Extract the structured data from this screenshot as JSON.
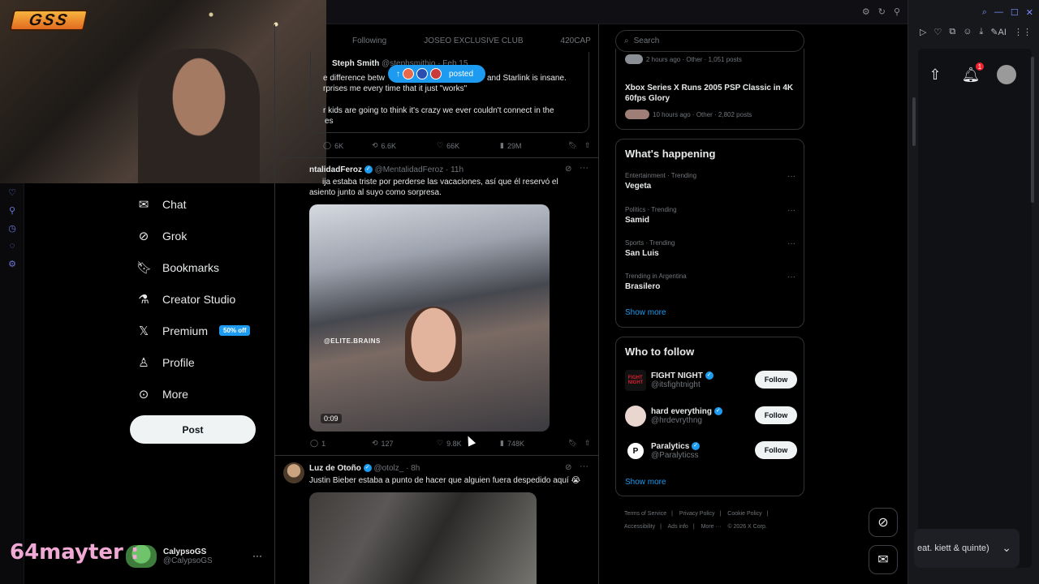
{
  "app_title": "X",
  "header": {
    "tabs": [
      {
        "label": "Following"
      },
      {
        "label": "JOSEO EXCLUSIVE CLUB"
      },
      {
        "label": "420CAP"
      }
    ]
  },
  "overlay": {
    "logo_text": "GSS",
    "chat_user": "64mayter :"
  },
  "posted_pill": {
    "label": "posted",
    "arrow": "↑"
  },
  "nav": {
    "items": [
      {
        "label": "Chat",
        "icon": "mail-icon"
      },
      {
        "label": "Grok",
        "icon": "grok-icon"
      },
      {
        "label": "Bookmarks",
        "icon": "bookmark-icon"
      },
      {
        "label": "Creator Studio",
        "icon": "creator-icon"
      },
      {
        "label": "Premium",
        "icon": "x-logo-icon",
        "badge": "50% off"
      },
      {
        "label": "Profile",
        "icon": "person-icon"
      },
      {
        "label": "More",
        "icon": "more-circle-icon"
      }
    ],
    "post_button": "Post"
  },
  "account": {
    "name": "CalypsoGS",
    "handle": "@CalypsoGS",
    "more": "···"
  },
  "quote_tweet": {
    "name": "Steph Smith",
    "handle": "@stephsmithio · Feb 15",
    "line1": "e difference betw",
    "line1b": "and Starlink is insane.",
    "line2": "rprises me every time that it just \"works\"",
    "line3": "r kids are going to think it's crazy we ever couldn't connect in the",
    "line4": "es",
    "stats": {
      "replies": "6K",
      "reposts": "6.6K",
      "likes": "66K",
      "views": "29M"
    }
  },
  "tweet1": {
    "name": "ntalidadFeroz",
    "handle": "@MentalidadFeroz · 11h",
    "line1": "ija estaba triste por perderse las vacaciones, así que él reservó el",
    "line2": "asiento junto al suyo como sorpresa.",
    "video_watermark": "@ELITE.BRAINS",
    "video_time": "0:09",
    "stats": {
      "replies": "1",
      "reposts": "127",
      "likes": "9.8K",
      "views": "748K"
    }
  },
  "tweet2": {
    "name": "Luz de Otoño",
    "handle": "@otolz_ · 8h",
    "text": "Justin Bieber estaba a punto de hacer que alguien fuera despedido aquí 😭"
  },
  "search": {
    "placeholder": "Search"
  },
  "top_trending": {
    "item0_meta": "2 hours ago · Other · 1,051 posts",
    "item1_title": "Xbox Series X Runs 2005 PSP Classic in 4K 60fps Glory",
    "item1_meta": "10 hours ago · Other · 2,802 posts"
  },
  "whats_happening": {
    "title": "What's happening",
    "trends": [
      {
        "meta": "Entertainment · Trending",
        "topic": "Vegeta"
      },
      {
        "meta": "Politics · Trending",
        "topic": "Samid"
      },
      {
        "meta": "Sports · Trending",
        "topic": "San Luis"
      },
      {
        "meta": "Trending in Argentina",
        "topic": "Brasilero"
      }
    ],
    "show_more": "Show more"
  },
  "who_to_follow": {
    "title": "Who to follow",
    "accounts": [
      {
        "name": "FIGHT NIGHT",
        "handle": "@itsfightnight"
      },
      {
        "name": "hard everything",
        "handle": "@hrdevrythng"
      },
      {
        "name": "Paralytics",
        "handle": "@Paralyticss"
      }
    ],
    "follow_label": "Follow",
    "show_more": "Show more"
  },
  "footer": {
    "links": [
      "Terms of Service",
      "|",
      "Privacy Policy",
      "|",
      "Cookie Policy",
      "|",
      "Accessibility",
      "|",
      "Ads info",
      "|",
      "More ···",
      "© 2026 X Corp."
    ]
  },
  "music": {
    "text": "eat. kiett & quinte)"
  },
  "notifications_count": "1",
  "colors": {
    "accent": "#1d9bf0",
    "background": "#000000",
    "text": "#e7e9ea",
    "muted": "#71767b"
  }
}
